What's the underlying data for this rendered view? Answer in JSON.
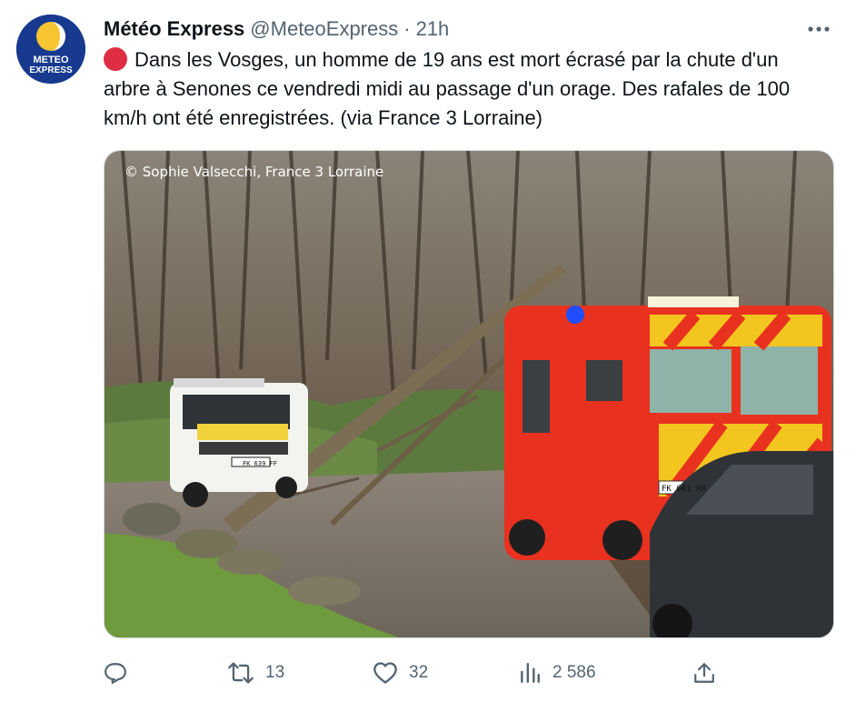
{
  "tweet": {
    "display_name": "Météo Express",
    "handle": "@MeteoExpress",
    "separator": "·",
    "time": "21h",
    "avatar_text_line1": "METEO",
    "avatar_text_line2": "EXPRESS",
    "status_emoji": "red-circle",
    "text": "Dans les Vosges, un homme de 19 ans est mort écrasé par la chute d'un arbre à Senones ce vendredi midi au passage d'un orage. Des rafales de 100 km/h ont été enregistrées. (via France 3 Lorraine)",
    "more_icon": "more-horizontal-icon"
  },
  "media": {
    "credit": "© Sophie Valsecchi, France 3 Lorraine",
    "plate_left": "FK 639 FF",
    "plate_right": "FK 661 XR"
  },
  "actions": {
    "reply": {
      "icon": "reply-icon",
      "count": ""
    },
    "retweet": {
      "icon": "retweet-icon",
      "count": "13"
    },
    "like": {
      "icon": "heart-icon",
      "count": "32"
    },
    "views": {
      "icon": "views-icon",
      "count": "2 586"
    },
    "share": {
      "icon": "share-icon",
      "count": ""
    }
  },
  "colors": {
    "avatar_bg": "#173a8f",
    "avatar_sun": "#f6c531",
    "emoji_red": "#dd2e44",
    "muted": "#536471",
    "text": "#0f1419"
  }
}
